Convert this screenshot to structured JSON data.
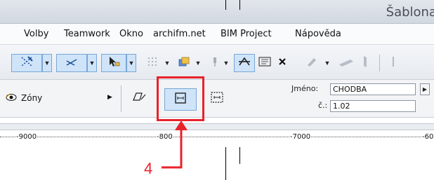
{
  "window": {
    "title": "Šablona"
  },
  "menu": {
    "items": [
      "Volby",
      "Teamwork",
      "Okno",
      "archifm.net",
      "BIM Project",
      "Nápověda"
    ]
  },
  "zone": {
    "label": "Zóny"
  },
  "room": {
    "name_label": "Jméno:",
    "name_value": "CHODBA",
    "number_label": "č.:",
    "number_value": "1.02"
  },
  "ruler": {
    "labels": [
      "-9000",
      "-800",
      "-7000",
      "-60"
    ]
  },
  "annotation": {
    "step_number": "4",
    "color": "#e8222a"
  },
  "colors": {
    "highlight": "#e8222a",
    "selected_tool_bg": "#cfe4f8",
    "selected_tool_border": "#7aa6d6"
  }
}
